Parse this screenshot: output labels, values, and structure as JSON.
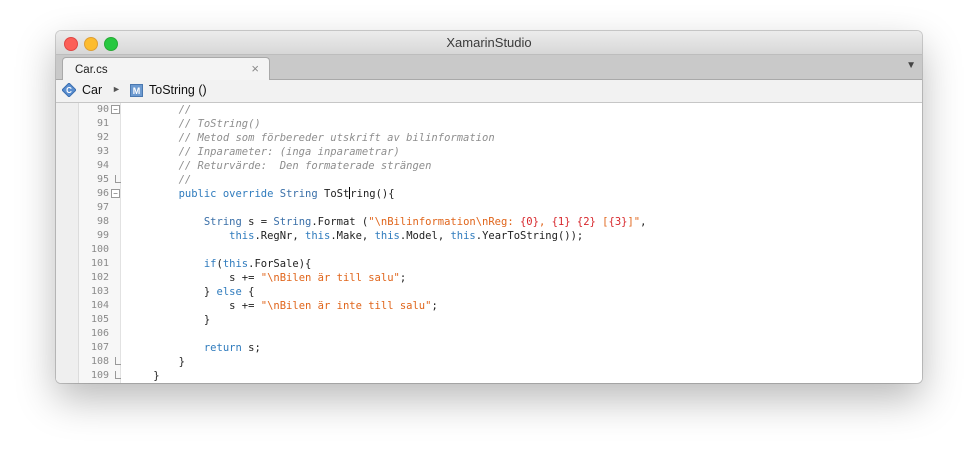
{
  "window": {
    "title": "XamarinStudio"
  },
  "tab": {
    "label": "Car.cs",
    "close_glyph": "×",
    "menu_glyph": "▼"
  },
  "pathbar": {
    "class_icon": "class-icon",
    "class_name": "Car",
    "separator": "►",
    "method_icon_letter": "M",
    "method_name": "ToString ()"
  },
  "editor": {
    "lines": [
      {
        "num": "90",
        "fold": "open",
        "tokens": [
          {
            "c": "cm",
            "t": "        //"
          }
        ]
      },
      {
        "num": "91",
        "tokens": [
          {
            "c": "cm",
            "t": "        // ToString()"
          }
        ]
      },
      {
        "num": "92",
        "tokens": [
          {
            "c": "cm",
            "t": "        // Metod som förbereder utskrift av bilinformation"
          }
        ]
      },
      {
        "num": "93",
        "tokens": [
          {
            "c": "cm",
            "t": "        // Inparameter: (inga inparametrar)"
          }
        ]
      },
      {
        "num": "94",
        "tokens": [
          {
            "c": "cm",
            "t": "        // Returvärde:  Den formaterade strängen"
          }
        ]
      },
      {
        "num": "95",
        "fold": "end",
        "tokens": [
          {
            "c": "cm",
            "t": "        //"
          }
        ]
      },
      {
        "num": "96",
        "fold": "open",
        "tokens": [
          {
            "c": "",
            "t": "        "
          },
          {
            "c": "kw",
            "t": "public"
          },
          {
            "c": "",
            "t": " "
          },
          {
            "c": "kw",
            "t": "override"
          },
          {
            "c": "",
            "t": " "
          },
          {
            "c": "ty",
            "t": "String"
          },
          {
            "c": "",
            "t": " ToSt"
          },
          {
            "c": "caret",
            "t": ""
          },
          {
            "c": "",
            "t": "ring(){"
          }
        ]
      },
      {
        "num": "97",
        "tokens": []
      },
      {
        "num": "98",
        "tokens": [
          {
            "c": "",
            "t": "            "
          },
          {
            "c": "ty",
            "t": "String"
          },
          {
            "c": "",
            "t": " s = "
          },
          {
            "c": "ty",
            "t": "String"
          },
          {
            "c": "",
            "t": ".Format ("
          },
          {
            "c": "st",
            "t": "\"\\nBilinformation\\nReg: "
          },
          {
            "c": "fm",
            "t": "{0}"
          },
          {
            "c": "st",
            "t": ", "
          },
          {
            "c": "fm",
            "t": "{1}"
          },
          {
            "c": "st",
            "t": " "
          },
          {
            "c": "fm",
            "t": "{2}"
          },
          {
            "c": "st",
            "t": " ["
          },
          {
            "c": "fm",
            "t": "{3}"
          },
          {
            "c": "st",
            "t": "]\""
          },
          {
            "c": "",
            "t": ","
          }
        ]
      },
      {
        "num": "99",
        "tokens": [
          {
            "c": "",
            "t": "                "
          },
          {
            "c": "kw",
            "t": "this"
          },
          {
            "c": "",
            "t": ".RegNr, "
          },
          {
            "c": "kw",
            "t": "this"
          },
          {
            "c": "",
            "t": ".Make, "
          },
          {
            "c": "kw",
            "t": "this"
          },
          {
            "c": "",
            "t": ".Model, "
          },
          {
            "c": "kw",
            "t": "this"
          },
          {
            "c": "",
            "t": ".YearToString());"
          }
        ]
      },
      {
        "num": "100",
        "tokens": []
      },
      {
        "num": "101",
        "tokens": [
          {
            "c": "",
            "t": "            "
          },
          {
            "c": "kw",
            "t": "if"
          },
          {
            "c": "",
            "t": "("
          },
          {
            "c": "kw",
            "t": "this"
          },
          {
            "c": "",
            "t": ".ForSale){"
          }
        ]
      },
      {
        "num": "102",
        "tokens": [
          {
            "c": "",
            "t": "                s += "
          },
          {
            "c": "st",
            "t": "\"\\nBilen är till salu\""
          },
          {
            "c": "",
            "t": ";"
          }
        ]
      },
      {
        "num": "103",
        "tokens": [
          {
            "c": "",
            "t": "            } "
          },
          {
            "c": "kw",
            "t": "else"
          },
          {
            "c": "",
            "t": " {"
          }
        ]
      },
      {
        "num": "104",
        "tokens": [
          {
            "c": "",
            "t": "                s += "
          },
          {
            "c": "st",
            "t": "\"\\nBilen är inte till salu\""
          },
          {
            "c": "",
            "t": ";"
          }
        ]
      },
      {
        "num": "105",
        "tokens": [
          {
            "c": "",
            "t": "            }"
          }
        ]
      },
      {
        "num": "106",
        "tokens": []
      },
      {
        "num": "107",
        "tokens": [
          {
            "c": "",
            "t": "            "
          },
          {
            "c": "kw",
            "t": "return"
          },
          {
            "c": "",
            "t": " s;"
          }
        ]
      },
      {
        "num": "108",
        "fold": "end",
        "tokens": [
          {
            "c": "",
            "t": "        }"
          }
        ]
      },
      {
        "num": "109",
        "fold": "end",
        "tokens": [
          {
            "c": "",
            "t": "    }"
          }
        ]
      }
    ]
  }
}
